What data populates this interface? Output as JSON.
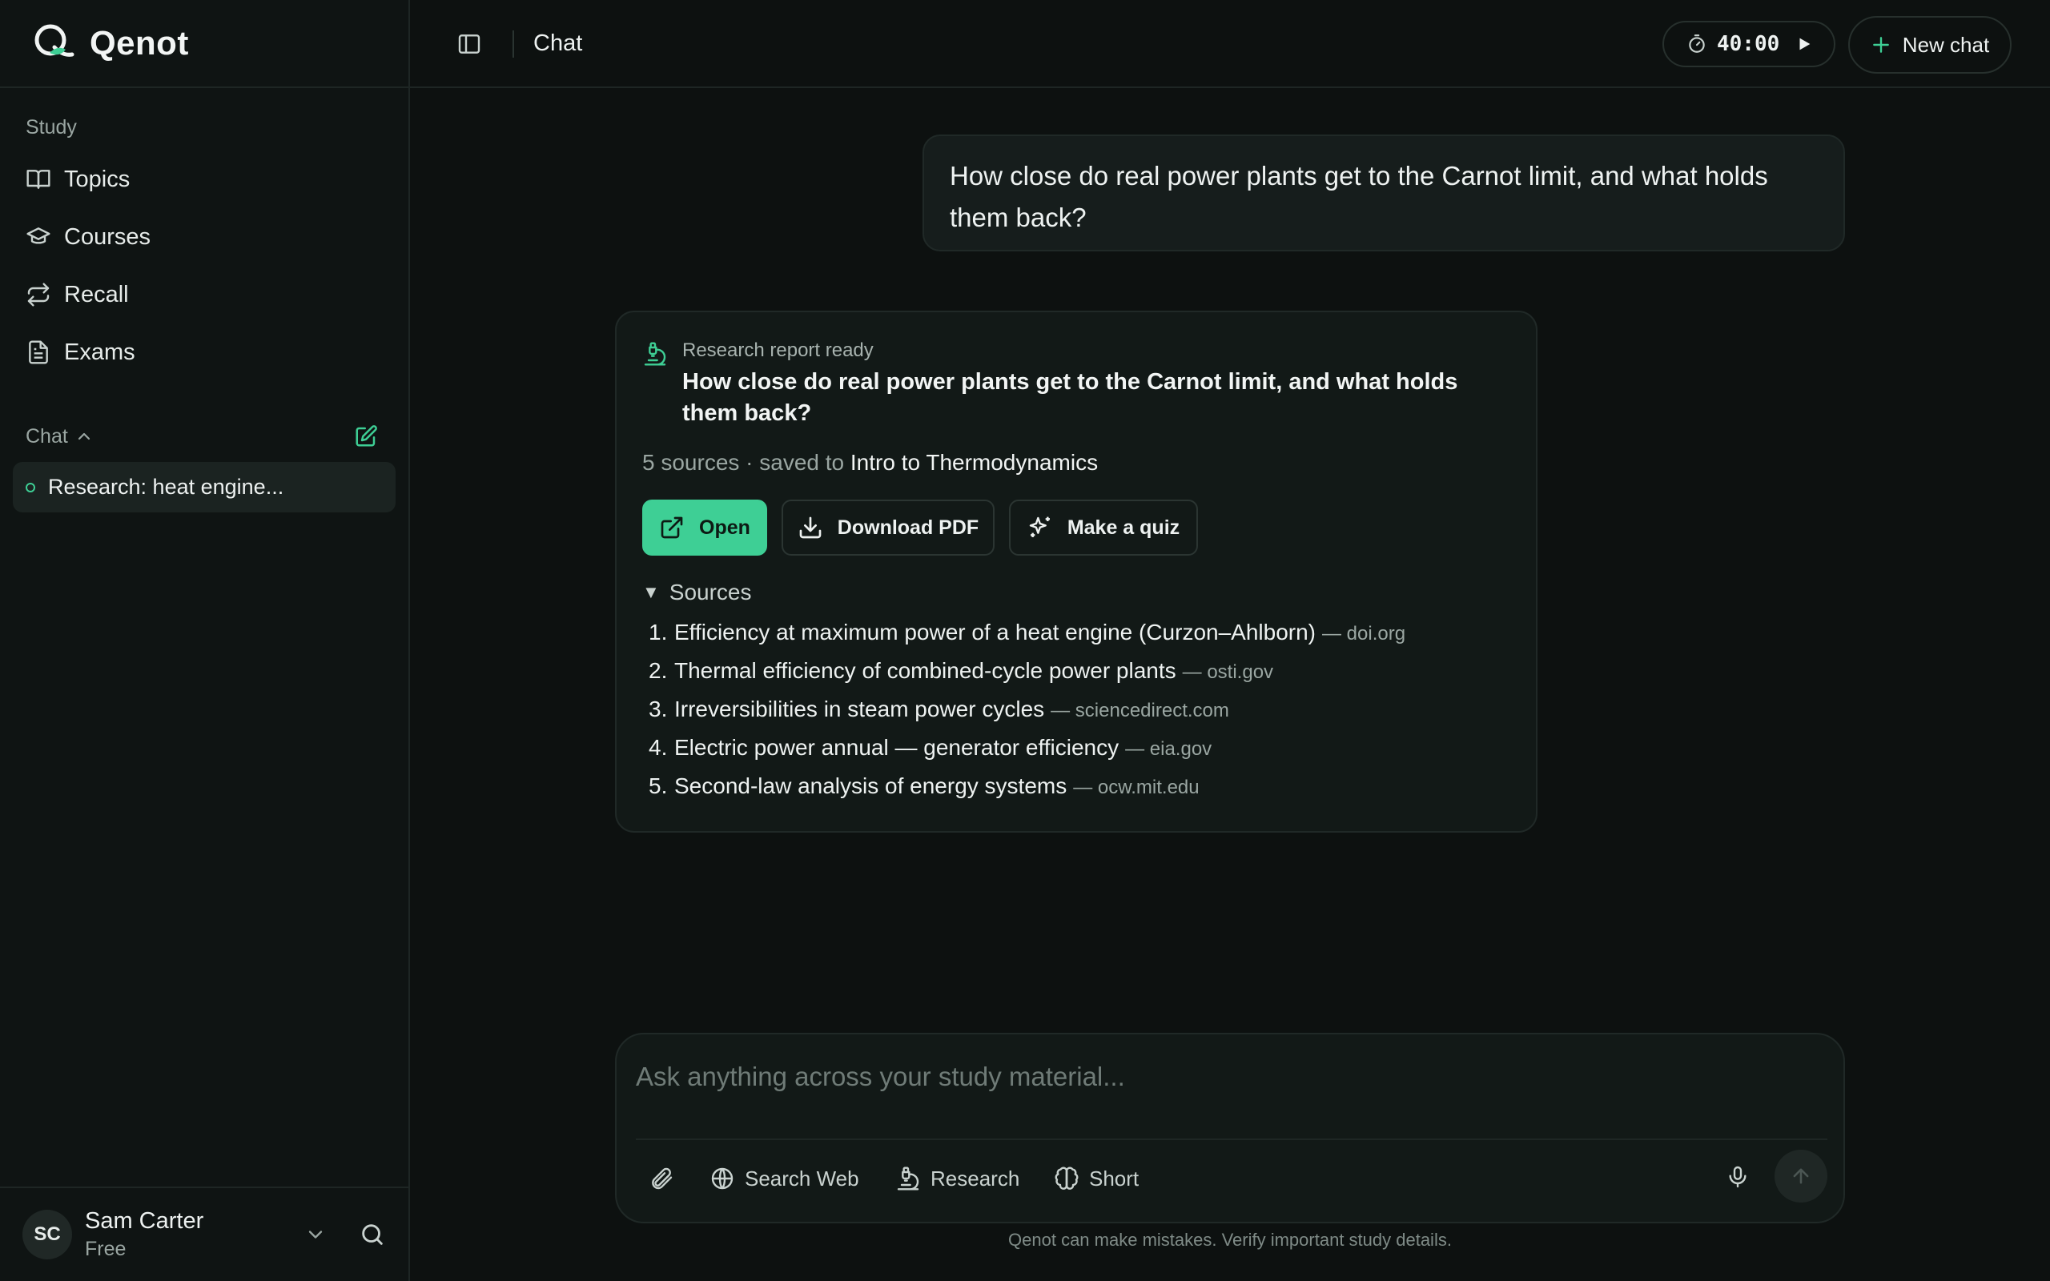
{
  "brand": {
    "name": "Qenot",
    "accent": "#3ecf95"
  },
  "sidebar": {
    "section_study": "Study",
    "nav": [
      {
        "label": "Topics",
        "icon": "book-open-icon"
      },
      {
        "label": "Courses",
        "icon": "graduation-cap-icon"
      },
      {
        "label": "Recall",
        "icon": "repeat-icon"
      },
      {
        "label": "Exams",
        "icon": "file-text-icon"
      }
    ],
    "section_chat": "Chat",
    "threads": [
      {
        "label": "Research: heat engine..."
      }
    ],
    "user": {
      "initials": "SC",
      "name": "Sam Carter",
      "plan": "Free"
    }
  },
  "topbar": {
    "title": "Chat",
    "timer": "40:00",
    "new_chat_label": "New chat"
  },
  "conversation": {
    "user_message": "How close do real power plants get to the Carnot limit, and what holds them back?",
    "report": {
      "status": "Research report ready",
      "title": "How close do real power plants get to the Carnot limit, and what holds them back?",
      "meta_prefix": "5 sources · saved to",
      "course": "Intro to Thermodynamics",
      "buttons": {
        "open": "Open",
        "download": "Download PDF",
        "quiz": "Make a quiz"
      },
      "sources_label": "Sources",
      "sources": [
        {
          "num": "1.",
          "title": "Efficiency at maximum power of a heat engine (Curzon–Ahlborn)",
          "domain": "— doi.org"
        },
        {
          "num": "2.",
          "title": "Thermal efficiency of combined-cycle power plants",
          "domain": "— osti.gov"
        },
        {
          "num": "3.",
          "title": "Irreversibilities in steam power cycles",
          "domain": "— sciencedirect.com"
        },
        {
          "num": "4.",
          "title": "Electric power annual — generator efficiency",
          "domain": "— eia.gov"
        },
        {
          "num": "5.",
          "title": "Second-law analysis of energy systems",
          "domain": "— ocw.mit.edu"
        }
      ]
    }
  },
  "composer": {
    "placeholder": "Ask anything across your study material...",
    "tools": {
      "web": "Search Web",
      "research": "Research",
      "short": "Short"
    },
    "disclaimer": "Qenot can make mistakes. Verify important study details."
  }
}
